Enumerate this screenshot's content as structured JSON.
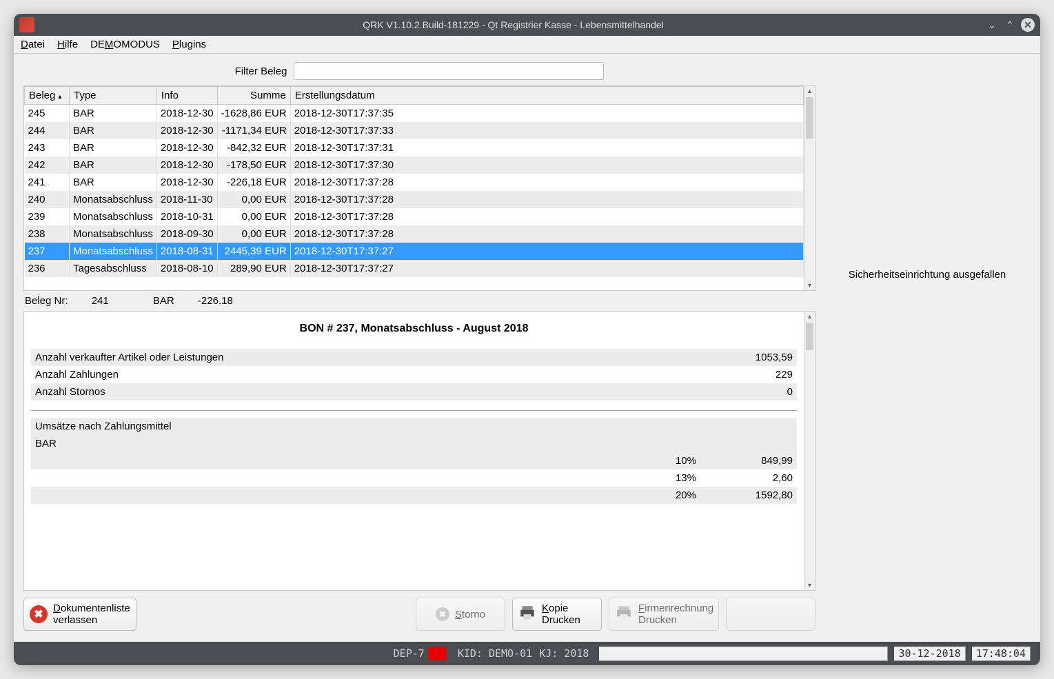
{
  "window": {
    "title": "QRK V1.10.2.Build-181229 - Qt Registrier Kasse - Lebensmittelhandel"
  },
  "menu": {
    "datei": "Datei",
    "hilfe": "Hilfe",
    "demomodus": "DEMOMODUS",
    "plugins": "Plugins"
  },
  "filter": {
    "label": "Filter Beleg",
    "value": ""
  },
  "table": {
    "headers": {
      "beleg": "Beleg",
      "type": "Type",
      "info": "Info",
      "summe": "Summe",
      "erst": "Erstellungsdatum"
    },
    "rows": [
      {
        "beleg": "245",
        "type": "BAR",
        "info": "2018-12-30",
        "summe": "-1628,86 EUR",
        "erst": "2018-12-30T17:37:35",
        "selected": false
      },
      {
        "beleg": "244",
        "type": "BAR",
        "info": "2018-12-30",
        "summe": "-1171,34 EUR",
        "erst": "2018-12-30T17:37:33",
        "selected": false
      },
      {
        "beleg": "243",
        "type": "BAR",
        "info": "2018-12-30",
        "summe": "-842,32 EUR",
        "erst": "2018-12-30T17:37:31",
        "selected": false
      },
      {
        "beleg": "242",
        "type": "BAR",
        "info": "2018-12-30",
        "summe": "-178,50 EUR",
        "erst": "2018-12-30T17:37:30",
        "selected": false
      },
      {
        "beleg": "241",
        "type": "BAR",
        "info": "2018-12-30",
        "summe": "-226,18 EUR",
        "erst": "2018-12-30T17:37:28",
        "selected": false
      },
      {
        "beleg": "240",
        "type": "Monatsabschluss",
        "info": "2018-11-30",
        "summe": "0,00 EUR",
        "erst": "2018-12-30T17:37:28",
        "selected": false
      },
      {
        "beleg": "239",
        "type": "Monatsabschluss",
        "info": "2018-10-31",
        "summe": "0,00 EUR",
        "erst": "2018-12-30T17:37:28",
        "selected": false
      },
      {
        "beleg": "238",
        "type": "Monatsabschluss",
        "info": "2018-09-30",
        "summe": "0,00 EUR",
        "erst": "2018-12-30T17:37:28",
        "selected": false
      },
      {
        "beleg": "237",
        "type": "Monatsabschluss",
        "info": "2018-08-31",
        "summe": "2445,39 EUR",
        "erst": "2018-12-30T17:37:27",
        "selected": true
      },
      {
        "beleg": "236",
        "type": "Tagesabschluss",
        "info": "2018-08-10",
        "summe": "289,90 EUR",
        "erst": "2018-12-30T17:37:27",
        "selected": false
      }
    ]
  },
  "infoLine": {
    "belegLabel": "Beleg Nr:",
    "belegNr": "241",
    "type": "BAR",
    "amount": "-226.18"
  },
  "detail": {
    "title": "BON # 237, Monatsabschluss - August 2018",
    "rows": [
      {
        "label": "Anzahl verkaufter Artikel oder Leistungen",
        "pct": "",
        "val": "1053,59",
        "alt": true
      },
      {
        "label": "Anzahl Zahlungen",
        "pct": "",
        "val": "229",
        "alt": false
      },
      {
        "label": "Anzahl Stornos",
        "pct": "",
        "val": "0",
        "alt": true
      }
    ],
    "section2": "Umsätze nach Zahlungsmittel",
    "payment": "BAR",
    "taxRows": [
      {
        "label": "",
        "pct": "10%",
        "val": "849,99",
        "alt": true
      },
      {
        "label": "",
        "pct": "13%",
        "val": "2,60",
        "alt": false
      },
      {
        "label": "",
        "pct": "20%",
        "val": "1592,80",
        "alt": true
      }
    ]
  },
  "sideMessage": "Sicherheitseinrichtung ausgefallen",
  "buttons": {
    "leave_l1": "Dokumentenliste",
    "leave_l2": "verlassen",
    "storno": "Storno",
    "kopie": "Kopie Drucken",
    "firmen_l1": "Firmenrechnung",
    "firmen_l2": "Drucken"
  },
  "status": {
    "dep": "DEP-7",
    "kid": "KID: DEMO-01",
    "kj": "KJ: 2018",
    "date": "30-12-2018",
    "time": "17:48:04"
  }
}
